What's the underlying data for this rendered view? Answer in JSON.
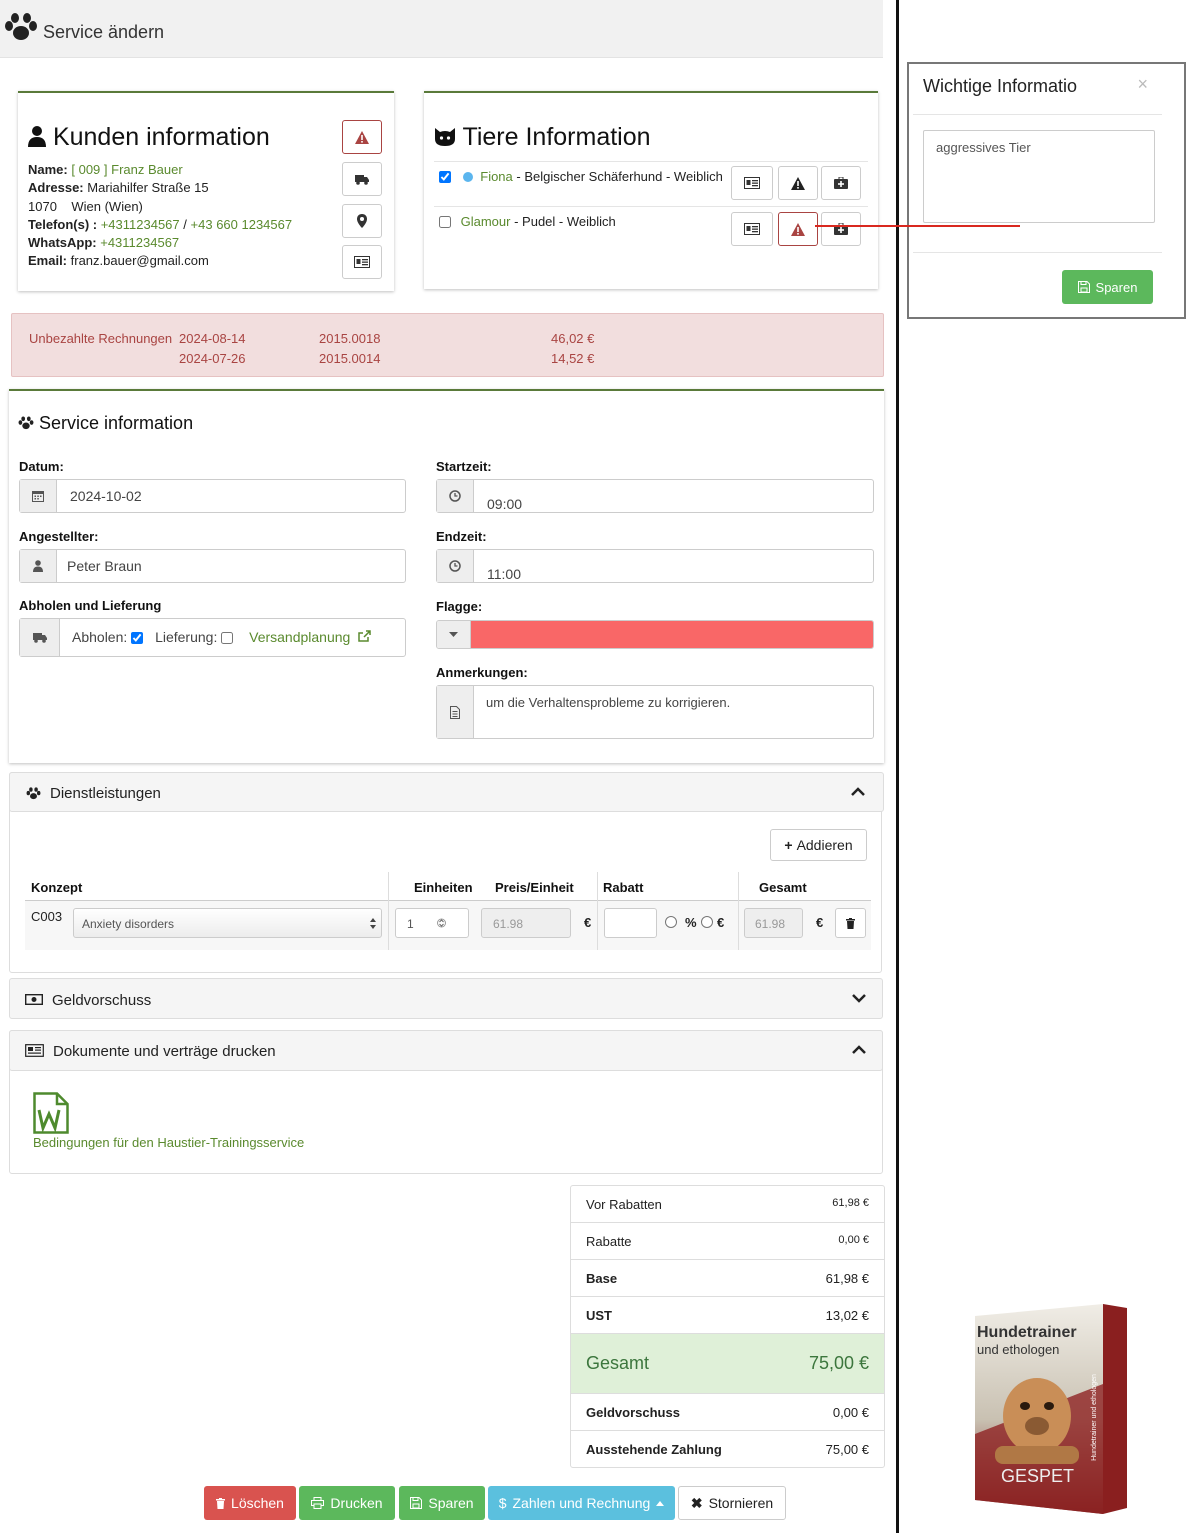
{
  "header": {
    "title": "Service ändern"
  },
  "customer": {
    "heading": "Kunden information",
    "name_label": "Name:",
    "name_value": "[ 009 ] Franz Bauer",
    "address_label": "Adresse:",
    "address_value": "Mariahilfer Straße 15",
    "city_line": "1070    Wien (Wien)",
    "phone_label": "Telefon(s) :",
    "phone_1": "+4311234567",
    "phone_sep": "/",
    "phone_2": "+43 660 1234567",
    "whatsapp_label": "WhatsApp:",
    "whatsapp_value": "+4311234567",
    "email_label": "Email:",
    "email_value": "franz.bauer@gmail.com"
  },
  "pets": {
    "heading": "Tiere Information",
    "items": [
      {
        "name": "Fiona",
        "details": " - Belgischer Schäferhund - Weiblich",
        "checked": true
      },
      {
        "name": "Glamour",
        "details": " - Pudel - Weiblich",
        "checked": false
      }
    ]
  },
  "modal": {
    "title": "Wichtige Informatio",
    "close": "×",
    "text": "aggressives Tier",
    "save_label": "Sparen"
  },
  "unpaid": {
    "label": "Unbezahlte Rechnungen",
    "rows": [
      {
        "date": "2024-08-14",
        "number": "2015.0018",
        "amount": "46,02 €"
      },
      {
        "date": "2024-07-26",
        "number": "2015.0014",
        "amount": "14,52 €"
      }
    ]
  },
  "service": {
    "heading": "Service information",
    "date_label": "Datum:",
    "date_value": "2024-10-02",
    "start_label": "Startzeit:",
    "start_value": "09:00",
    "employee_label": "Angestellter:",
    "employee_value": "Peter Braun",
    "end_label": "Endzeit:",
    "end_value": "11:00",
    "pickup_heading": "Abholen und Lieferung",
    "pickup_label": "Abholen:",
    "delivery_label": "Lieferung:",
    "shipping_link": "Versandplanung",
    "flag_label": "Flagge:",
    "flag_color": "#f96767",
    "notes_label": "Anmerkungen:",
    "notes_value": "um die Verhaltensprobleme zu korrigieren."
  },
  "services_panel": {
    "title": "Dienstleistungen",
    "add_label": "Addieren",
    "columns": {
      "concept": "Konzept",
      "units": "Einheiten",
      "unit_price": "Preis/Einheit",
      "discount": "Rabatt",
      "total": "Gesamt"
    },
    "row": {
      "code": "C003",
      "concept": "Anxiety disorders",
      "units": "1",
      "unit_price": "61.98",
      "currency": "€",
      "pct": "%",
      "eur": "€",
      "total": "61.98"
    }
  },
  "advance_panel": {
    "title": "Geldvorschuss"
  },
  "docs_panel": {
    "title": "Dokumente und verträge drucken",
    "doc_label": "Bedingungen für den Haustier-Trainingsservice"
  },
  "totals": {
    "before_discount_label": "Vor Rabatten",
    "before_discount": "61,98 €",
    "discounts_label": "Rabatte",
    "discounts": "0,00 €",
    "base_label": "Base",
    "base": "61,98 €",
    "vat_label": "UST",
    "vat": "13,02 €",
    "total_label": "Gesamt",
    "total": "75,00 €",
    "advance_label": "Geldvorschuss",
    "advance": "0,00 €",
    "pending_label": "Ausstehende Zahlung",
    "pending": "75,00 €"
  },
  "actions": {
    "delete": "Löschen",
    "print": "Drucken",
    "save": "Sparen",
    "pay": "Zahlen und Rechnung",
    "cancel": "Stornieren"
  },
  "product": {
    "title": "Hundetrainer",
    "subtitle": "und ethologen",
    "brand": "GESPET",
    "spine": "Hundetrainer und ethologen"
  },
  "colors": {
    "accent_green": "#5a8a2e",
    "danger": "#d9534f",
    "success": "#5cb85c",
    "info": "#5bc0de",
    "total_bg": "#dff0d8"
  }
}
